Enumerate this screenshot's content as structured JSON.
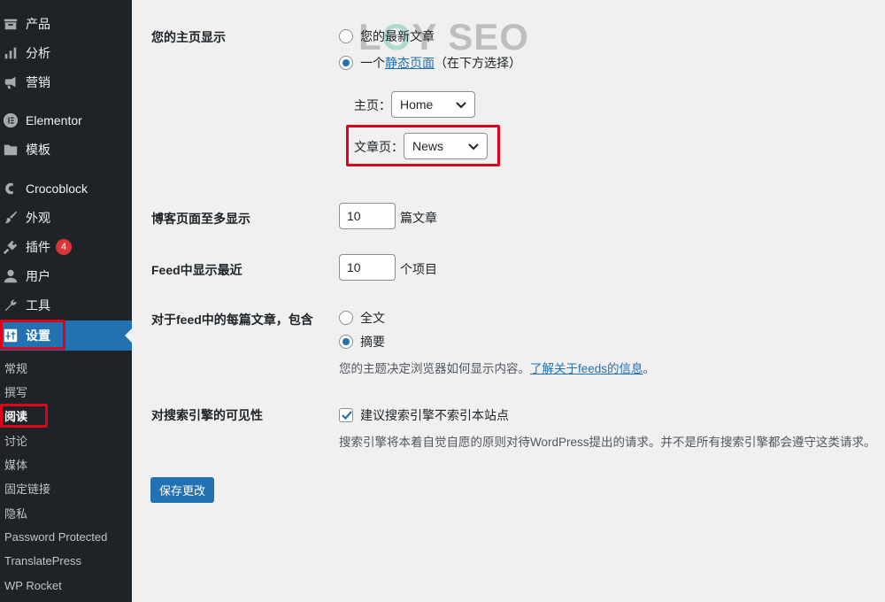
{
  "sidebar": {
    "items": [
      {
        "label": "产品",
        "icon": "archive-icon"
      },
      {
        "label": "分析",
        "icon": "bar-chart-icon"
      },
      {
        "label": "营销",
        "icon": "megaphone-icon"
      },
      {
        "label": "Elementor",
        "icon": "elementor-icon"
      },
      {
        "label": "模板",
        "icon": "folder-icon"
      },
      {
        "label": "Crocoblock",
        "icon": "crocoblock-icon"
      },
      {
        "label": "外观",
        "icon": "paintbrush-icon"
      },
      {
        "label": "插件",
        "icon": "plugin-icon",
        "badge": "4"
      },
      {
        "label": "用户",
        "icon": "user-icon"
      },
      {
        "label": "工具",
        "icon": "wrench-icon"
      },
      {
        "label": "设置",
        "icon": "settings-icon",
        "current": true
      }
    ],
    "submenu": [
      {
        "label": "常规"
      },
      {
        "label": "撰写"
      },
      {
        "label": "阅读",
        "current": true
      },
      {
        "label": "讨论"
      },
      {
        "label": "媒体"
      },
      {
        "label": "固定链接"
      },
      {
        "label": "隐私"
      },
      {
        "label": "Password Protected"
      },
      {
        "label": "TranslatePress"
      },
      {
        "label": "WP Rocket"
      }
    ]
  },
  "watermark": {
    "text_l": "L",
    "text_o": "O",
    "text_rest": "Y SEO"
  },
  "homepage": {
    "label": "您的主页显示",
    "option_latest": "您的最新文章",
    "option_static_prefix": "一个",
    "option_static_link": "静态页面",
    "option_static_suffix": "（在下方选择）",
    "homepage_label": "主页：",
    "homepage_value": "Home",
    "posts_page_label": "文章页：",
    "posts_page_value": "News"
  },
  "blog_pages": {
    "label": "博客页面至多显示",
    "value": "10",
    "unit": "篇文章"
  },
  "feed_items": {
    "label": "Feed中显示最近",
    "value": "10",
    "unit": "个项目"
  },
  "feed_content": {
    "label": "对于feed中的每篇文章，包含",
    "option_full": "全文",
    "option_summary": "摘要",
    "desc_prefix": "您的主题决定浏览器如何显示内容。",
    "desc_link": "了解关于feeds的信息",
    "desc_suffix": "。"
  },
  "search_visibility": {
    "label": "对搜索引擎的可见性",
    "checkbox_label": "建议搜索引擎不索引本站点",
    "desc": "搜索引擎将本着自觉自愿的原则对待WordPress提出的请求。并不是所有搜索引擎都会遵守这类请求。"
  },
  "save_button": "保存更改",
  "colors": {
    "sidebar_bg": "#1d2327",
    "accent": "#2271b1",
    "highlight": "#e0001b",
    "page_bg": "#f0f0f1"
  }
}
